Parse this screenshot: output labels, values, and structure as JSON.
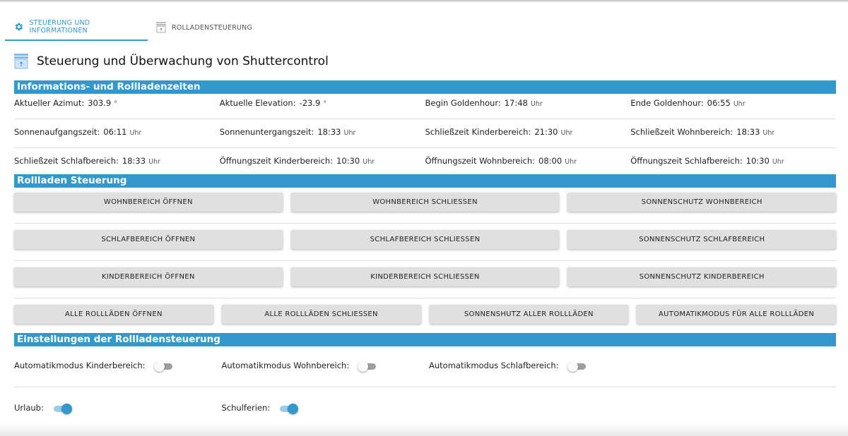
{
  "tabs": [
    {
      "label": "STEUERUNG UND INFORMATIONEN",
      "icon": "gear-icon"
    },
    {
      "label": "ROLLADENSTEUERUNG",
      "icon": "shutter-icon"
    }
  ],
  "page_title": "Steuerung und Überwachung von Shuttercontrol",
  "accent": "#3399cc",
  "sections": {
    "info": "Informations- und Rollladenzeiten",
    "control": "Rollladen Steuerung",
    "settings": "Einstellungen der Rollladensteuerung"
  },
  "info_rows": [
    [
      {
        "label": "Aktueller Azimut:",
        "value": "303.9",
        "unit": "°"
      },
      {
        "label": "Aktuelle Elevation:",
        "value": "-23.9",
        "unit": "°"
      },
      {
        "label": "Begin Goldenhour:",
        "value": "17:48",
        "unit": "Uhr"
      },
      {
        "label": "Ende Goldenhour:",
        "value": "06:55",
        "unit": "Uhr"
      }
    ],
    [
      {
        "label": "Sonnenaufgangszeit:",
        "value": "06:11",
        "unit": "Uhr"
      },
      {
        "label": "Sonnenuntergangszeit:",
        "value": "18:33",
        "unit": "Uhr"
      },
      {
        "label": "Schließzeit Kinderbereich:",
        "value": "21:30",
        "unit": "Uhr"
      },
      {
        "label": "Schließzeit Wohnbereich:",
        "value": "18:33",
        "unit": "Uhr"
      }
    ],
    [
      {
        "label": "Schließzeit Schlafbereich:",
        "value": "18:33",
        "unit": "Uhr"
      },
      {
        "label": "Öffnungszeit Kinderbereich:",
        "value": "10:30",
        "unit": "Uhr"
      },
      {
        "label": "Öffnungszeit Wohnbereich:",
        "value": "08:00",
        "unit": "Uhr"
      },
      {
        "label": "Öffnungszeit Schlafbereich:",
        "value": "10:30",
        "unit": "Uhr"
      }
    ]
  ],
  "button_rows": [
    [
      "WOHNBEREICH ÖFFNEN",
      "WOHNBEREICH SCHLIESSEN",
      "SONNENSCHUTZ WOHNBEREICH"
    ],
    [
      "SCHLAFBEREICH ÖFFNEN",
      "SCHLAFBEREICH SCHLIESSEN",
      "SONNENSCHUTZ SCHLAFBEREICH"
    ],
    [
      "KINDERBEREICH ÖFFNEN",
      "KINDERBEREICH SCHLIESSEN",
      "SONNENSCHUTZ KINDERBEREICH"
    ],
    [
      "ALLE ROLLLÄDEN ÖFFNEN",
      "ALLE ROLLLÄDEN SCHLIESSEN",
      "SONNENSHUTZ ALLER ROLLLÄDEN",
      "AUTOMATIKMODUS FÜR ALLE ROLLLÄDEN"
    ]
  ],
  "toggle_rows": [
    [
      {
        "label": "Automatikmodus Kinderbereich:",
        "on": false
      },
      {
        "label": "Automatikmodus Wohnbereich:",
        "on": false
      },
      {
        "label": "Automatikmodus Schlafbereich:",
        "on": false
      }
    ],
    [
      {
        "label": "Urlaub:",
        "on": true
      },
      {
        "label": "Schulferien:",
        "on": true
      }
    ]
  ]
}
